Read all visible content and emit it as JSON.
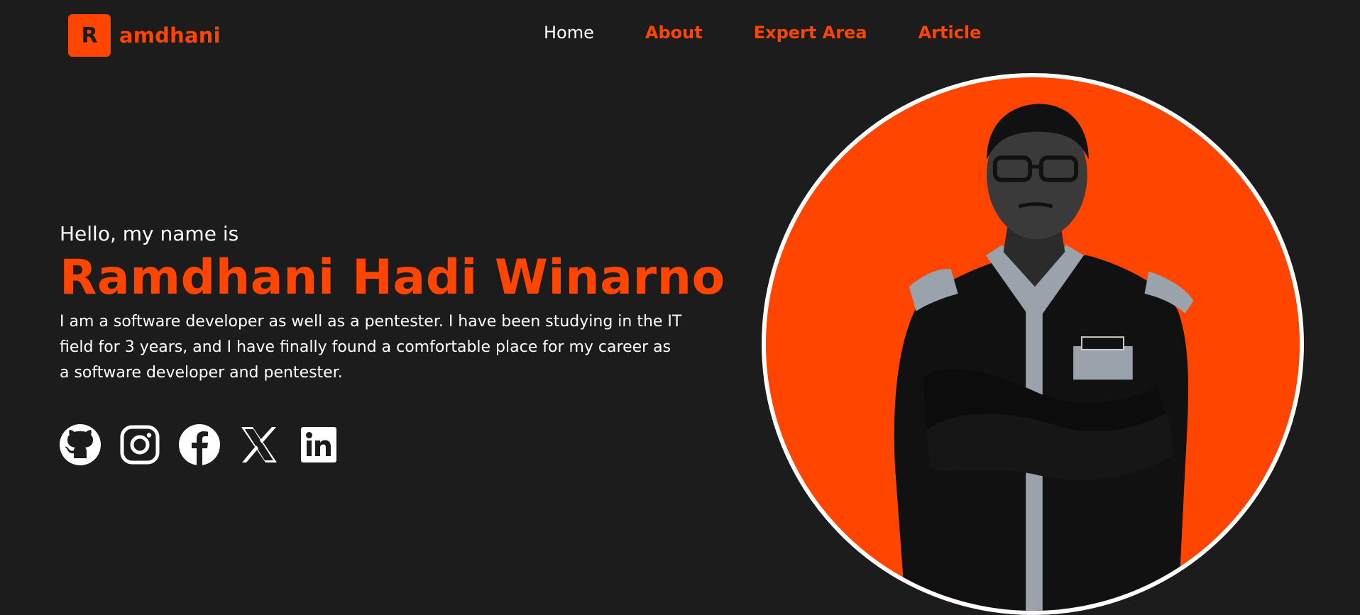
{
  "brand": {
    "badge_letter": "R",
    "name_text": "amdhani",
    "accent_color": "#ff4500",
    "background_color": "#1c1c1c"
  },
  "nav": {
    "items": [
      {
        "label": "Home"
      },
      {
        "label": "About"
      },
      {
        "label": "Expert Area"
      },
      {
        "label": "Article"
      }
    ]
  },
  "hero": {
    "greeting": "Hello, my name is",
    "name": "Ramdhani Hadi Winarno",
    "bio_lines": [
      "I am a software developer as well as a pentester. I have been studying in the IT",
      "field for 3 years, and I have finally found a comfortable place for my career as",
      "a software developer and pentester."
    ]
  },
  "socials": [
    {
      "icon": "github-icon"
    },
    {
      "icon": "instagram-icon"
    },
    {
      "icon": "facebook-icon"
    },
    {
      "icon": "x-icon"
    },
    {
      "icon": "linkedin-icon"
    }
  ],
  "portrait": {
    "icon": "profile-photo",
    "background_color": "#ff4500",
    "border_color": "#ffffff"
  }
}
